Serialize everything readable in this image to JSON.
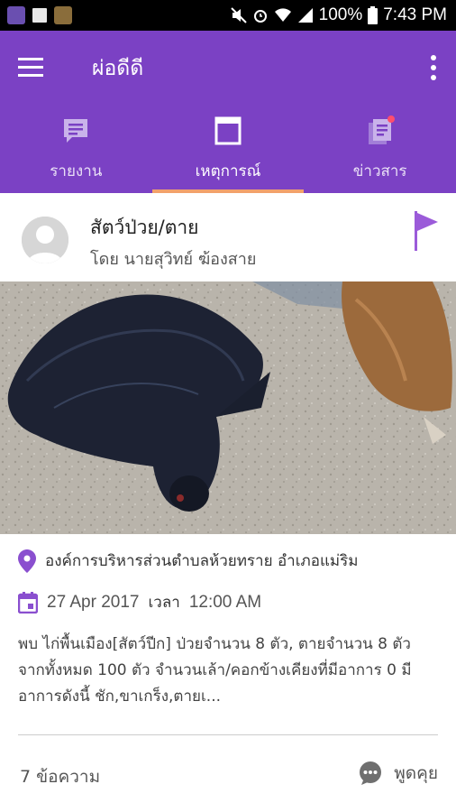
{
  "status_bar": {
    "battery": "100%",
    "time": "7:43 PM",
    "notification_icons": [
      "gallery-icon",
      "image-icon",
      "game-icon"
    ]
  },
  "app_bar": {
    "title": "ผ่อดีดี",
    "color": "#7b41c4"
  },
  "tabs": [
    {
      "label": "รายงาน",
      "icon": "report-icon",
      "active": false
    },
    {
      "label": "เหตุการณ์",
      "icon": "event-icon",
      "active": true
    },
    {
      "label": "ข่าวสาร",
      "icon": "news-icon",
      "active": false,
      "has_badge": true
    }
  ],
  "post": {
    "title": "สัตว์ป่วย/ตาย",
    "author": "โดย นายสุวิทย์ ฆ้องสาย",
    "location": "องค์การบริหารส่วนตำบลห้วยทราย อำเภอแม่ริม",
    "date": "27 Apr 2017",
    "time_label": "เวลา",
    "time": "12:00 AM",
    "description": "พบ ไก่พื้นเมือง[สัตว์ปีก] ป่วยจำนวน 8 ตัว, ตายจำนวน 8 ตัว จากทั้งหมด 100 ตัว จำนวนเล้า/คอกข้างเคียงที่มีอาการ 0 มีอาการดังนี้ ชัก,ขาเกร็ง,ตายเ...",
    "message_count": "7 ข้อความ",
    "chat_label": "พูดคุย"
  },
  "colors": {
    "accent": "#7b41c4",
    "tab_indicator": "#f2a16b",
    "badge": "#ff4d6d"
  }
}
